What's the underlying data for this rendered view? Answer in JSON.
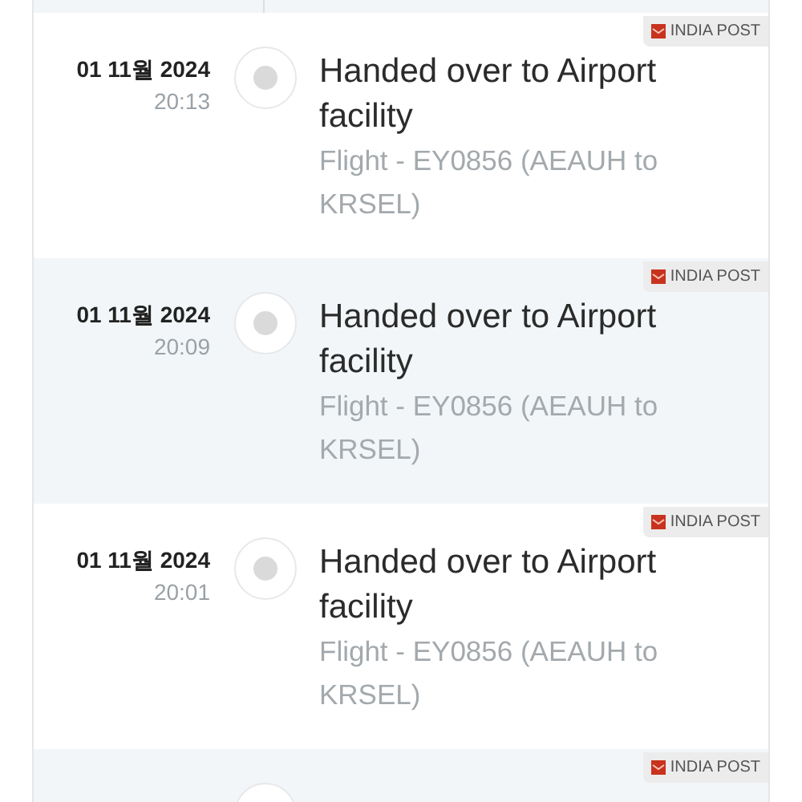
{
  "events": [
    {
      "date": "01 11월 2024",
      "time": "20:13",
      "title": "Handed over to Airport facility",
      "detail": "Flight - EY0856 (AEAUH to KRSEL)",
      "carrier": "INDIA POST"
    },
    {
      "date": "01 11월 2024",
      "time": "20:09",
      "title": "Handed over to Airport facility",
      "detail": "Flight - EY0856 (AEAUH to KRSEL)",
      "carrier": "INDIA POST"
    },
    {
      "date": "01 11월 2024",
      "time": "20:01",
      "title": "Handed over to Airport facility",
      "detail": "Flight - EY0856 (AEAUH to KRSEL)",
      "carrier": "INDIA POST"
    },
    {
      "carrier": "INDIA POST"
    }
  ]
}
